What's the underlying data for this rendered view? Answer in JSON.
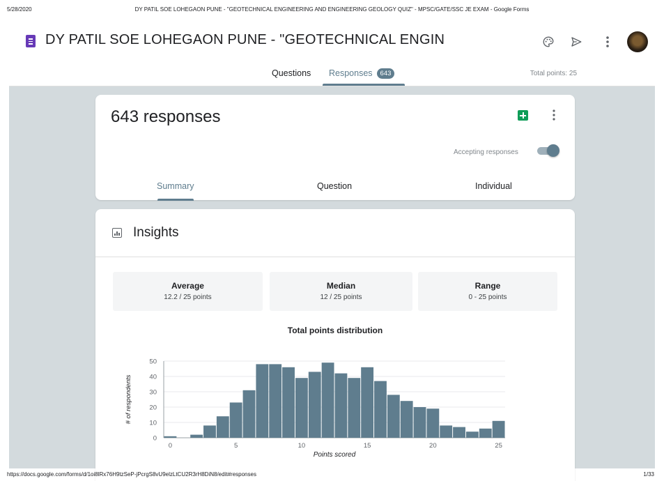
{
  "print": {
    "date": "5/28/2020",
    "page_title": "DY PATIL SOE LOHEGAON PUNE - \"GEOTECHNICAL ENGINEERING AND ENGINEERING GEOLOGY QUIZ\" - MPSC/GATE/SSC JE EXAM - Google Forms",
    "url": "https://docs.google.com/forms/d/1oi8lRx76H9tzSeP-jPcrgS8vU9elzLtCU2R3rH8DiN8/edit#responses",
    "page_number": "1/33"
  },
  "app": {
    "form_title": "DY PATIL SOE LOHEGAON PUNE  - \"GEOTECHNICAL ENGIN",
    "icons": [
      "palette-icon",
      "send-icon",
      "more-vert-icon"
    ]
  },
  "tabs": {
    "questions": "Questions",
    "responses": "Responses",
    "responses_count": "643",
    "total_points": "Total points: 25"
  },
  "responses_card": {
    "title": "643 responses",
    "accepting_label": "Accepting responses",
    "accepting": true,
    "subtabs": [
      "Summary",
      "Question",
      "Individual"
    ]
  },
  "insights": {
    "title": "Insights",
    "stats": [
      {
        "label": "Average",
        "value": "12.2 / 25 points"
      },
      {
        "label": "Median",
        "value": "12 / 25 points"
      },
      {
        "label": "Range",
        "value": "0 - 25 points"
      }
    ]
  },
  "colors": {
    "accent": "#5f7d8e",
    "background": "#d3dadd",
    "bar": "#5f7d8e",
    "sheets": "#0f9d58",
    "form_icon": "#673ab7"
  },
  "chart_data": {
    "type": "bar",
    "title": "Total points distribution",
    "xlabel": "Points scored",
    "ylabel": "# of respondents",
    "x": [
      0,
      1,
      2,
      3,
      4,
      5,
      6,
      7,
      8,
      9,
      10,
      11,
      12,
      13,
      14,
      15,
      16,
      17,
      18,
      19,
      20,
      21,
      22,
      23,
      24,
      25
    ],
    "values": [
      1,
      0,
      2,
      8,
      14,
      23,
      31,
      48,
      48,
      46,
      39,
      43,
      49,
      42,
      39,
      46,
      37,
      28,
      24,
      20,
      19,
      8,
      7,
      4,
      6,
      11
    ],
    "xticks": [
      0,
      5,
      10,
      15,
      20,
      25
    ],
    "yticks": [
      0,
      10,
      20,
      30,
      40,
      50
    ],
    "ylim": [
      0,
      50
    ],
    "grid": "horizontal"
  }
}
